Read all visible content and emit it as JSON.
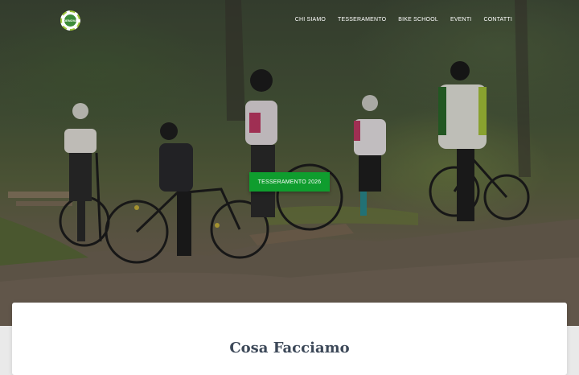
{
  "header": {
    "logo": {
      "text": "GENOVA",
      "icon": "club-logo-icon"
    },
    "nav": [
      "CHI SIAMO",
      "TESSERAMENTO",
      "BIKE SCHOOL",
      "EVENTI",
      "CONTATTI"
    ]
  },
  "hero": {
    "cta_label": "TESSERAMENTO 2026"
  },
  "section": {
    "title": "Cosa Facciamo"
  },
  "colors": {
    "accent": "#0f9d2e",
    "title_text": "#3c4858"
  }
}
